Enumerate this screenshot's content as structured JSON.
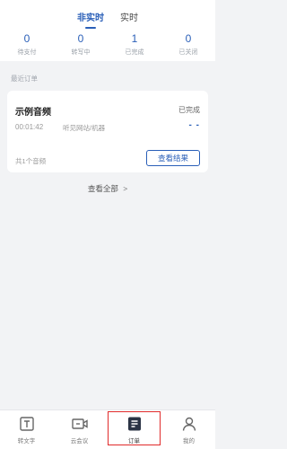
{
  "tabs": [
    {
      "label": "非实时",
      "active": true
    },
    {
      "label": "实时",
      "active": false
    }
  ],
  "stats": [
    {
      "value": "0",
      "label": "待支付"
    },
    {
      "value": "0",
      "label": "转写中"
    },
    {
      "value": "1",
      "label": "已完成"
    },
    {
      "value": "0",
      "label": "已关闭"
    }
  ],
  "recent_title": "最近订单",
  "order": {
    "name": "示例音频",
    "status": "已完成",
    "duration": "00:01:42",
    "source": "听见网站/机器",
    "dash": "- -",
    "count": "共1个音频",
    "result_button": "查看结果"
  },
  "view_all": "查看全部",
  "view_all_chevron": ">",
  "nav": [
    {
      "label": "转文字",
      "icon": "text-convert-icon"
    },
    {
      "label": "云会议",
      "icon": "video-meeting-icon"
    },
    {
      "label": "订单",
      "icon": "order-icon",
      "active": true
    },
    {
      "label": "我的",
      "icon": "user-icon"
    }
  ],
  "colors": {
    "accent": "#2a5fb8",
    "highlight": "#e02b2b"
  }
}
